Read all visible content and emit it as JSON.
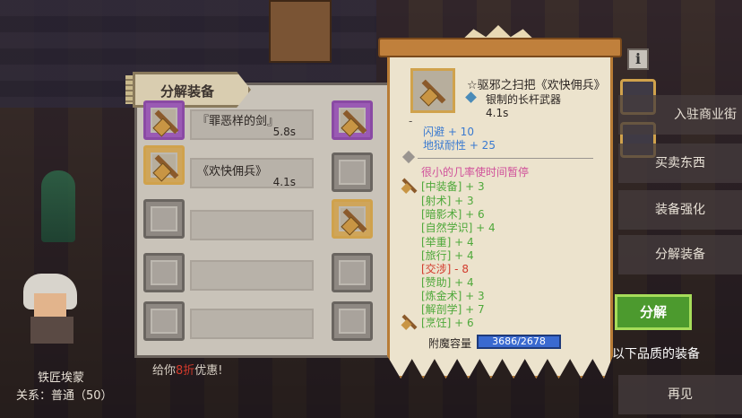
{
  "npc": {
    "name": "铁匠埃蒙",
    "relation": "关系：普通（50）"
  },
  "hint": {
    "prefix": "给你",
    "highlight": "8折",
    "suffix": "优惠!"
  },
  "salvage_panel": {
    "title": "分解装备",
    "items": [
      {
        "name": "『罪恶样的剑』",
        "time": "5.8s",
        "rarity": "purple"
      },
      {
        "name": "《欢快佣兵》",
        "time": "4.1s",
        "rarity": "orange"
      },
      {
        "name": "",
        "time": ""
      },
      {
        "name": "",
        "time": ""
      },
      {
        "name": "",
        "time": ""
      }
    ]
  },
  "tooltip": {
    "title": "☆驱邪之扫把《欢快佣兵》",
    "type": "银制的长杆武器",
    "cooldown": "4.1s",
    "dash": "-",
    "stats": [
      "闪避 + 10",
      "地狱耐性 + 25"
    ],
    "effect": "很小的几率使时间暂停",
    "skills": [
      {
        "text": "[中装备] + 3",
        "negative": false
      },
      {
        "text": "[射术] + 3",
        "negative": false
      },
      {
        "text": "[暗影术] + 6",
        "negative": false
      },
      {
        "text": "[自然学识] + 4",
        "negative": false
      },
      {
        "text": "[举重] + 4",
        "negative": false
      },
      {
        "text": "[旅行] + 4",
        "negative": false
      },
      {
        "text": "[交涉] - 8",
        "negative": true
      },
      {
        "text": "[赞助] + 4",
        "negative": false
      },
      {
        "text": "[炼金术] + 3",
        "negative": false
      },
      {
        "text": "[解剖学] + 7",
        "negative": false
      },
      {
        "text": "[烹饪] + 6",
        "negative": false
      }
    ],
    "capacity_label": "附魔容量",
    "capacity_value": "3686/2678"
  },
  "menu": {
    "items": [
      "入驻商业街",
      "买卖东西",
      "装备强化",
      "分解装备"
    ],
    "info_label": "i",
    "salvage_button": "分解",
    "quality_text": "以下品质的装备",
    "farewell": "再见"
  },
  "colors": {
    "skill_green": "#4ea83a",
    "skill_red": "#d23a2c",
    "stat_blue": "#3a7ad0",
    "effect_pink": "#d0509a",
    "button_green": "#4c9a2e"
  }
}
